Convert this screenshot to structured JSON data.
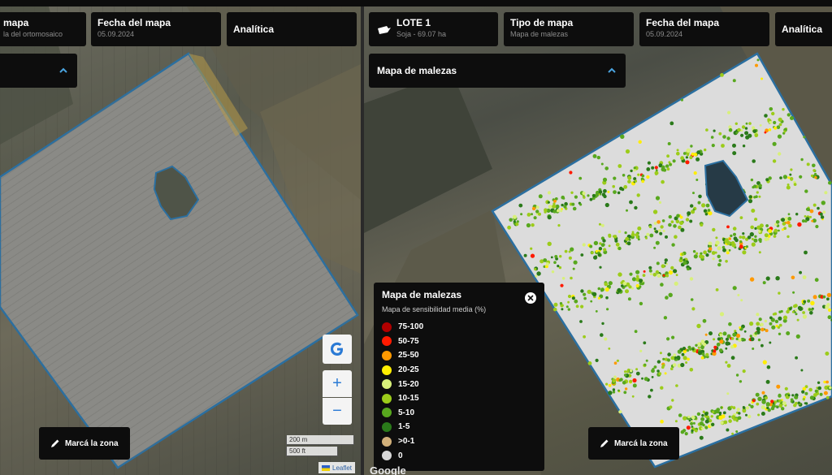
{
  "left": {
    "cards": [
      {
        "title": "mapa",
        "sub": "la del ortomosaico"
      },
      {
        "title": "Fecha del mapa",
        "sub": "05.09.2024"
      },
      {
        "title": "Analítica"
      }
    ],
    "zone_button": "Marcá la zona",
    "zoom_in": "+",
    "zoom_out": "−",
    "scale": [
      "200 m",
      "500 ft"
    ],
    "attribution": "Leaflet"
  },
  "right": {
    "cards": [
      {
        "title": "LOTE 1",
        "sub": "Soja - 69.07 ha"
      },
      {
        "title": "Tipo de mapa",
        "sub": "Mapa de malezas"
      },
      {
        "title": "Fecha del mapa",
        "sub": "05.09.2024"
      },
      {
        "title": "Analítica"
      }
    ],
    "dropdown": "Mapa de malezas",
    "zone_button": "Marcá la zona",
    "google": "Google"
  },
  "legend": {
    "title": "Mapa de malezas",
    "subtitle": "Mapa de sensibilidad media (%)",
    "items": [
      {
        "label": "75-100",
        "color": "#b00000"
      },
      {
        "label": "50-75",
        "color": "#ff1a00"
      },
      {
        "label": "25-50",
        "color": "#ff9900"
      },
      {
        "label": "20-25",
        "color": "#ffee00"
      },
      {
        "label": "15-20",
        "color": "#d8f07a"
      },
      {
        "label": "10-15",
        "color": "#9ccc1a"
      },
      {
        "label": "5-10",
        "color": "#58a81e"
      },
      {
        "label": "1-5",
        "color": "#2a7a1a"
      },
      {
        "label": ">0-1",
        "color": "#d2b07a"
      },
      {
        "label": "0",
        "color": "#d8d8d8"
      }
    ]
  }
}
